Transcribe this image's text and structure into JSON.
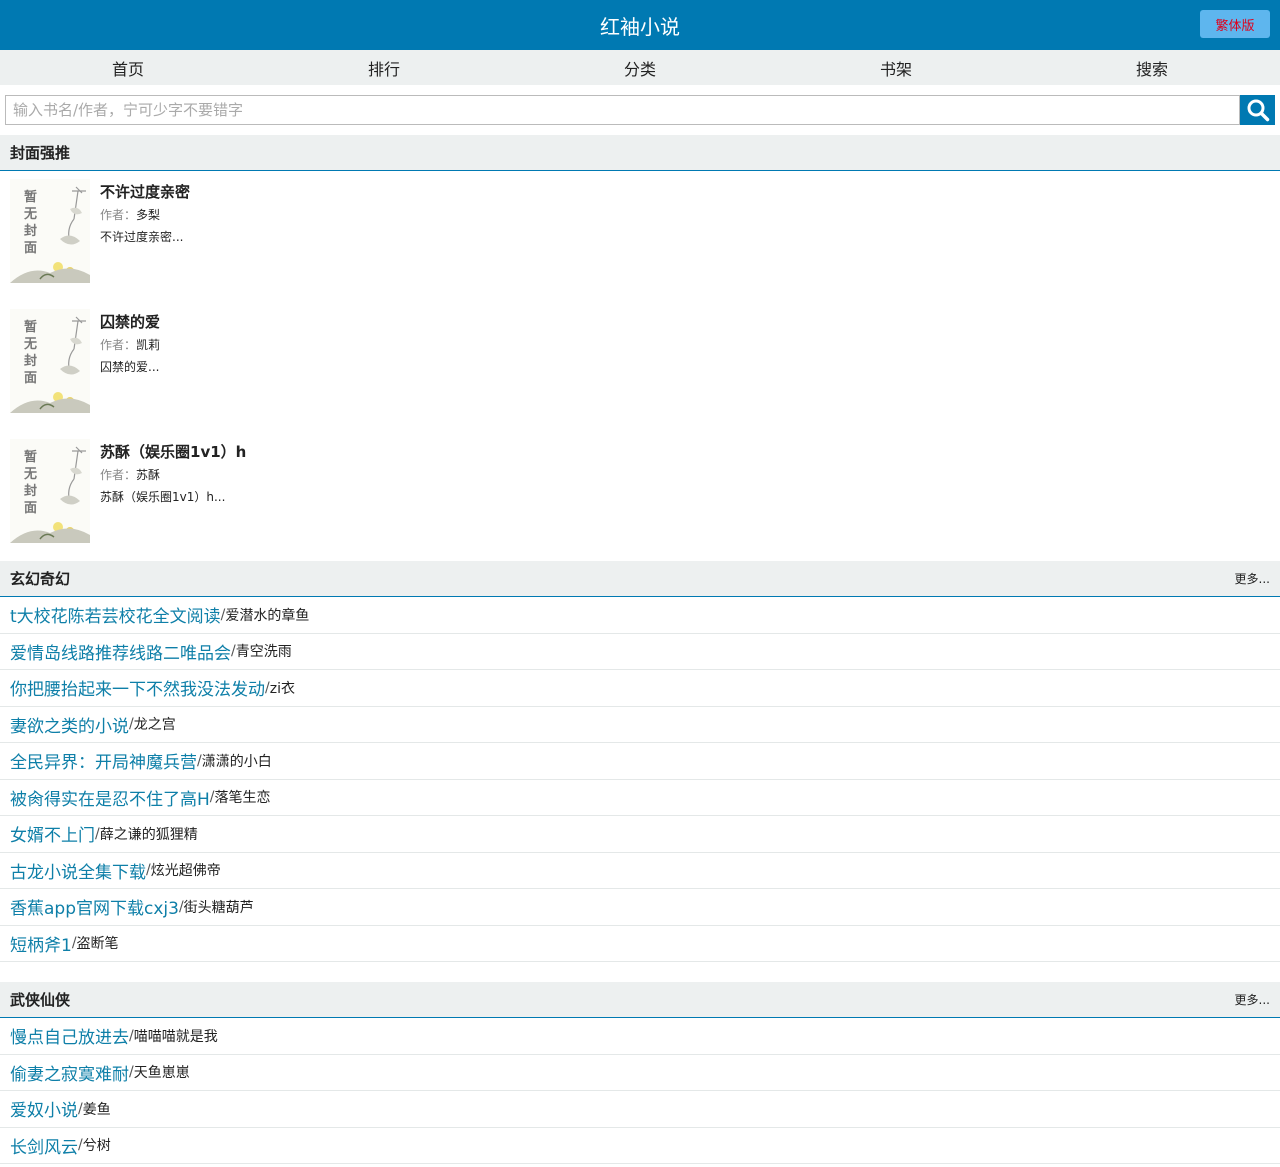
{
  "header": {
    "title": "红袖小说",
    "trad_label": "繁体版"
  },
  "nav": [
    "首页",
    "排行",
    "分类",
    "书架",
    "搜索"
  ],
  "search": {
    "placeholder": "输入书名/作者，宁可少字不要错字"
  },
  "cover_text": "暂无封面",
  "featured": {
    "title": "封面强推",
    "author_label": "作者：",
    "books": [
      {
        "title": "不许过度亲密",
        "author": "多梨",
        "desc": "不许过度亲密..."
      },
      {
        "title": "囚禁的爱",
        "author": "凯莉",
        "desc": "囚禁的爱..."
      },
      {
        "title": "苏酥（娱乐圈1v1）h",
        "author": "苏酥",
        "desc": "苏酥（娱乐圈1v1）h..."
      }
    ]
  },
  "sections": [
    {
      "title": "玄幻奇幻",
      "more": "更多...",
      "items": [
        {
          "title": "t大校花陈若芸校花全文阅读",
          "author": "爱潜水的章鱼"
        },
        {
          "title": "爱情岛线路推荐线路二唯品会",
          "author": "青空洗雨"
        },
        {
          "title": "你把腰抬起来一下不然我没法发动",
          "author": "zi衣"
        },
        {
          "title": "妻欲之类的小说",
          "author": "龙之宫"
        },
        {
          "title": "全民异界：开局神魔兵营",
          "author": "潇潇的小白"
        },
        {
          "title": "被肏得实在是忍不住了高H",
          "author": "落笔生恋"
        },
        {
          "title": "女婿不上门",
          "author": "薛之谦的狐狸精"
        },
        {
          "title": "古龙小说全集下载",
          "author": "炫光超佛帝"
        },
        {
          "title": "香蕉app官网下载cxj3",
          "author": "街头糖葫芦"
        },
        {
          "title": "短柄斧1",
          "author": "盗断笔"
        }
      ]
    },
    {
      "title": "武侠仙侠",
      "more": "更多...",
      "items": [
        {
          "title": "慢点自己放进去",
          "author": "喵喵喵就是我"
        },
        {
          "title": "偷妻之寂寞难耐",
          "author": "天鱼崽崽"
        },
        {
          "title": "爱奴小说",
          "author": "姜鱼"
        },
        {
          "title": "长剑风云",
          "author": "兮树"
        }
      ]
    }
  ],
  "colors": {
    "brand": "#0079b2",
    "link": "#0e7fa8",
    "trad_text": "#e0001b",
    "band": "#edf0f0"
  }
}
